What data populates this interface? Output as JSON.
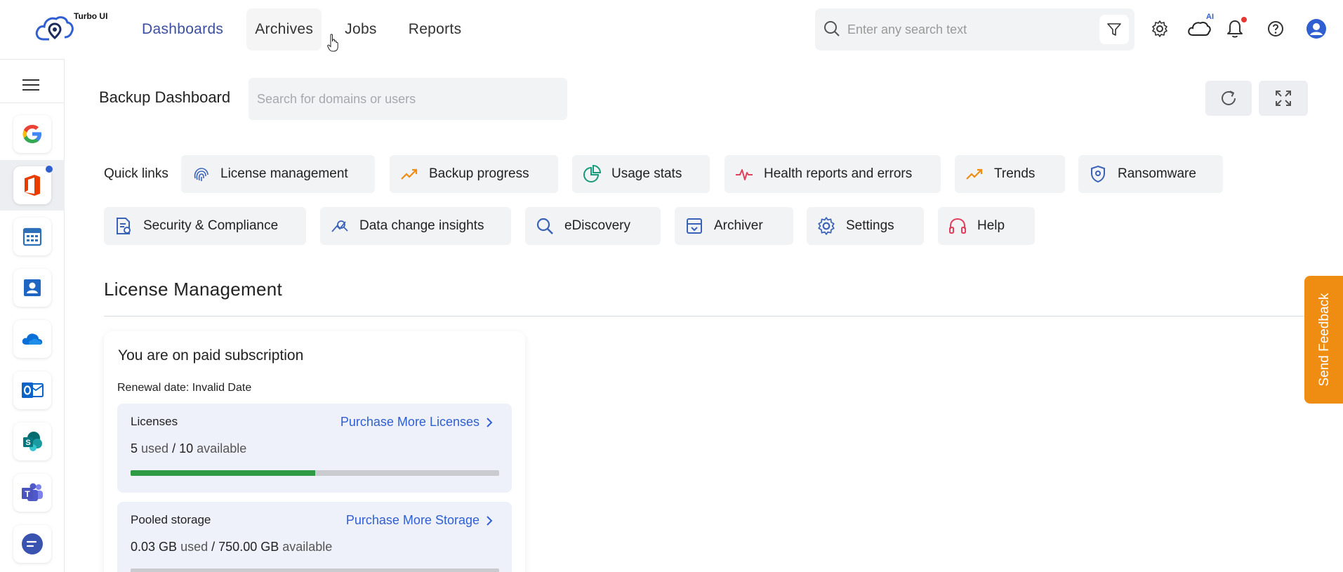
{
  "app": {
    "logo_text": "Turbo UI"
  },
  "nav": {
    "items": [
      "Dashboards",
      "Archives",
      "Jobs",
      "Reports"
    ]
  },
  "top_search": {
    "placeholder": "Enter any search text"
  },
  "top_icons": {
    "ai_badge": "AI"
  },
  "page": {
    "title": "Backup Dashboard",
    "search_placeholder": "Search for domains or users"
  },
  "quick_links": {
    "label": "Quick links",
    "row1": [
      "License management",
      "Backup progress",
      "Usage stats",
      "Health reports and errors",
      "Trends",
      "Ransomware"
    ],
    "row2": [
      "Security & Compliance",
      "Data change insights",
      "eDiscovery",
      "Archiver",
      "Settings",
      "Help"
    ]
  },
  "section": {
    "title": "License Management"
  },
  "card": {
    "title": "You are on paid subscription",
    "renewal": "Renewal date: Invalid Date",
    "licenses": {
      "title": "Licenses",
      "link": "Purchase More Licenses",
      "used": "5",
      "used_label": "used",
      "sep": "/",
      "available": "10",
      "available_label": "available",
      "fill_fraction": 0.5
    },
    "storage": {
      "title": "Pooled storage",
      "link": "Purchase More Storage",
      "used": "0.03 GB",
      "used_label": "used",
      "sep": "/",
      "available": "750.00 GB",
      "available_label": "available",
      "fill_fraction": 0.0
    }
  },
  "feedback": {
    "label": "Send Feedback"
  },
  "colors": {
    "accent": "#2f5fd0",
    "progress": "#2f9a44",
    "feedback": "#ef8d12",
    "nav_active": "#3b4fa0"
  }
}
